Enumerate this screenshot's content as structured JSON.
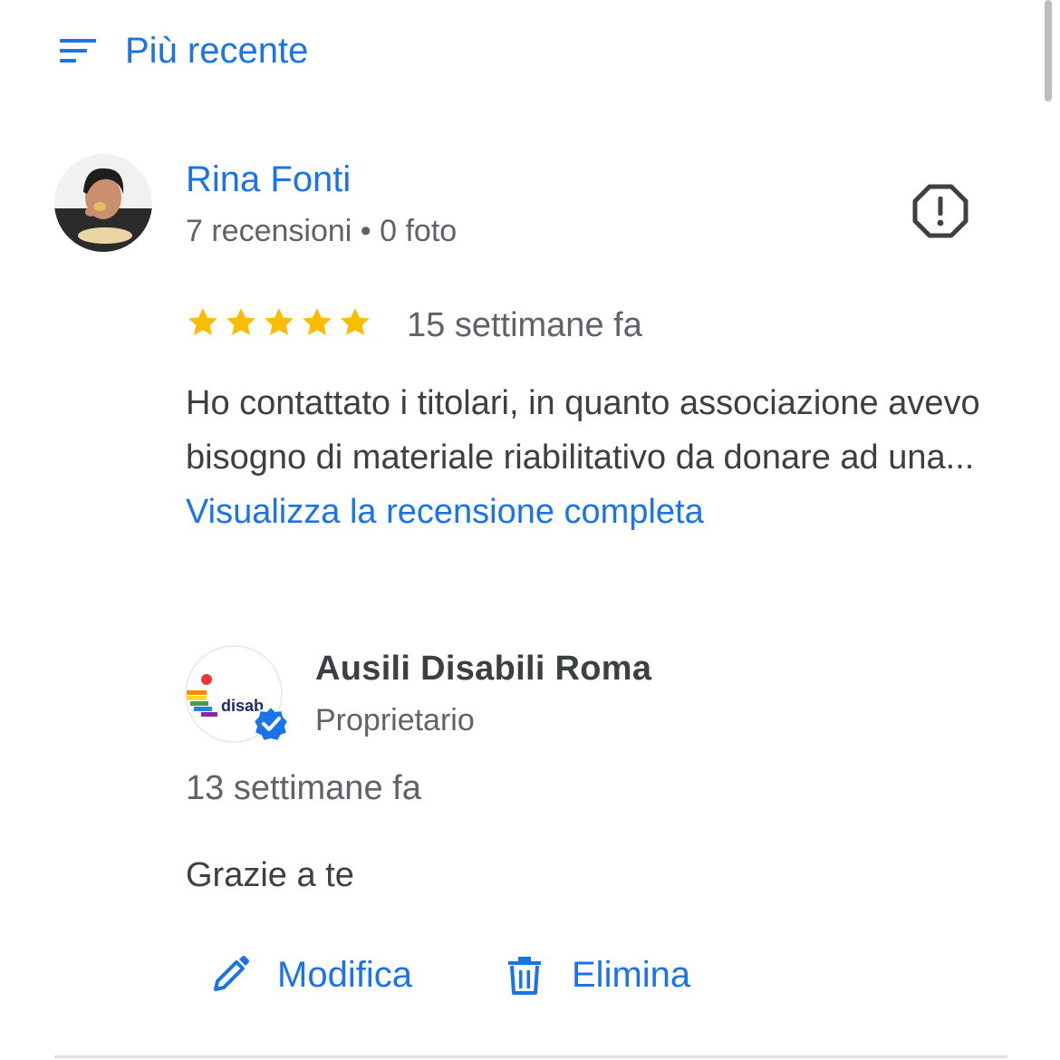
{
  "sort": {
    "label": "Più recente",
    "icon": "sort-icon"
  },
  "review": {
    "author": "Rina Fonti",
    "author_meta": "7 recensioni • 0 foto",
    "rating": 5,
    "rating_max": 5,
    "time": "15 settimane fa",
    "text": "Ho contattato i titolari, in quanto associazione avevo bisogno di materiale riabilitativo da donare ad una...",
    "more_link": "Visualizza la recensione completa",
    "report_icon": "report-icon"
  },
  "reply": {
    "owner_name": "Ausili Disabili Roma",
    "owner_role": "Proprietario",
    "owner_logo_text": "disab",
    "time": "13 settimane fa",
    "text": "Grazie a te"
  },
  "actions": {
    "edit_label": "Modifica",
    "delete_label": "Elimina"
  },
  "colors": {
    "accent": "#1a73e8",
    "star": "#fbbc04",
    "text": "#3c4043",
    "secondary_text": "#5f6368"
  }
}
